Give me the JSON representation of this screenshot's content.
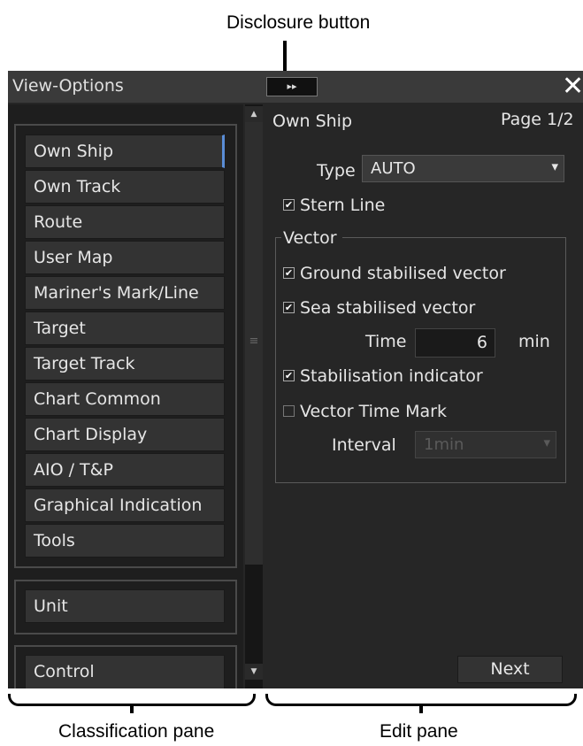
{
  "annotations": {
    "disclosure": "Disclosure button",
    "classification": "Classification pane",
    "edit": "Edit pane"
  },
  "window": {
    "title": "View-Options",
    "disclosure_glyph": "▸▸",
    "close_glyph": "✕"
  },
  "classification": {
    "items": [
      {
        "label": "Own Ship",
        "active": true
      },
      {
        "label": "Own Track"
      },
      {
        "label": "Route"
      },
      {
        "label": "User Map"
      },
      {
        "label": "Mariner's Mark/Line"
      },
      {
        "label": "Target"
      },
      {
        "label": "Target Track"
      },
      {
        "label": "Chart Common"
      },
      {
        "label": "Chart Display"
      },
      {
        "label": "AIO / T&P"
      },
      {
        "label": "Graphical Indication"
      },
      {
        "label": "Tools"
      }
    ],
    "unit": "Unit",
    "control": "Control",
    "scroll_up": "▲",
    "scroll_down": "▼",
    "scroll_grip": "≡"
  },
  "edit": {
    "heading": "Own Ship",
    "page": "Page 1/2",
    "type_label": "Type",
    "type_value": "AUTO",
    "dropdown_arrow": "▾",
    "stern_line": {
      "label": "Stern Line",
      "checked": true
    },
    "vector_group": "Vector",
    "ground_vector": {
      "label": "Ground stabilised vector",
      "checked": true
    },
    "sea_vector": {
      "label": "Sea stabilised vector",
      "checked": true
    },
    "time_label": "Time",
    "time_value": "6",
    "time_unit": "min",
    "stab_indicator": {
      "label": "Stabilisation indicator",
      "checked": true
    },
    "vector_time_mark": {
      "label": "Vector Time Mark",
      "checked": false
    },
    "interval_label": "Interval",
    "interval_value": "1min",
    "next": "Next",
    "check_glyph": "✔"
  }
}
